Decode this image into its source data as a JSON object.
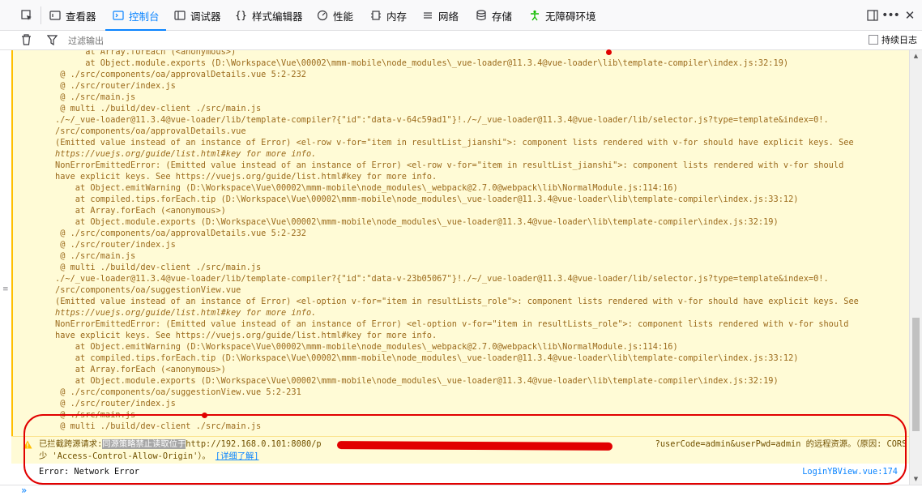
{
  "toolbar": {
    "tabs": [
      {
        "label": "查看器",
        "icon": "inspector-icon"
      },
      {
        "label": "控制台",
        "icon": "console-icon",
        "active": true
      },
      {
        "label": "调试器",
        "icon": "debugger-icon"
      },
      {
        "label": "样式编辑器",
        "icon": "style-editor-icon"
      },
      {
        "label": "性能",
        "icon": "performance-icon"
      },
      {
        "label": "内存",
        "icon": "memory-icon"
      },
      {
        "label": "网络",
        "icon": "network-icon"
      },
      {
        "label": "存储",
        "icon": "storage-icon"
      },
      {
        "label": "无障碍环境",
        "icon": "accessibility-icon"
      }
    ],
    "accent": "#0a84ff"
  },
  "filterbar": {
    "placeholder": "过滤输出",
    "persist_label": "持续日志"
  },
  "log": {
    "lines": [
      "      at Array.forEach (<anonymous>)",
      "      at Object.module.exports (D:\\Workspace\\Vue\\00002\\mmm-mobile\\node_modules\\_vue-loader@11.3.4@vue-loader\\lib\\template-compiler\\index.js:32:19)",
      " @ ./src/components/oa/approvalDetails.vue 5:2-232",
      " @ ./src/router/index.js",
      " @ ./src/main.js",
      " @ multi ./build/dev-client ./src/main.js",
      "./~/_vue-loader@11.3.4@vue-loader/lib/template-compiler?{\"id\":\"data-v-64c59ad1\"}!./~/_vue-loader@11.3.4@vue-loader/lib/selector.js?type=template&index=0!.",
      "/src/components/oa/approvalDetails.vue",
      "(Emitted value instead of an instance of Error) <el-row v-for=\"item in resultList_jianshi\">: component lists rendered with v-for should have explicit keys. See",
      "https://vuejs.org/guide/list.html#key for more info.",
      "NonErrorEmittedError: (Emitted value instead of an instance of Error) <el-row v-for=\"item in resultList_jianshi\">: component lists rendered with v-for should",
      "have explicit keys. See https://vuejs.org/guide/list.html#key for more info.",
      "    at Object.emitWarning (D:\\Workspace\\Vue\\00002\\mmm-mobile\\node_modules\\_webpack@2.7.0@webpack\\lib\\NormalModule.js:114:16)",
      "    at compiled.tips.forEach.tip (D:\\Workspace\\Vue\\00002\\mmm-mobile\\node_modules\\_vue-loader@11.3.4@vue-loader\\lib\\template-compiler\\index.js:33:12)",
      "    at Array.forEach (<anonymous>)",
      "    at Object.module.exports (D:\\Workspace\\Vue\\00002\\mmm-mobile\\node_modules\\_vue-loader@11.3.4@vue-loader\\lib\\template-compiler\\index.js:32:19)",
      " @ ./src/components/oa/approvalDetails.vue 5:2-232",
      " @ ./src/router/index.js",
      " @ ./src/main.js",
      " @ multi ./build/dev-client ./src/main.js",
      "./~/_vue-loader@11.3.4@vue-loader/lib/template-compiler?{\"id\":\"data-v-23b05067\"}!./~/_vue-loader@11.3.4@vue-loader/lib/selector.js?type=template&index=0!.",
      "/src/components/oa/suggestionView.vue",
      "(Emitted value instead of an instance of Error) <el-option v-for=\"item in resultLists_role\">: component lists rendered with v-for should have explicit keys. See",
      "https://vuejs.org/guide/list.html#key for more info.",
      "NonErrorEmittedError: (Emitted value instead of an instance of Error) <el-option v-for=\"item in resultLists_role\">: component lists rendered with v-for should",
      "have explicit keys. See https://vuejs.org/guide/list.html#key for more info.",
      "    at Object.emitWarning (D:\\Workspace\\Vue\\00002\\mmm-mobile\\node_modules\\_webpack@2.7.0@webpack\\lib\\NormalModule.js:114:16)",
      "    at compiled.tips.forEach.tip (D:\\Workspace\\Vue\\00002\\mmm-mobile\\node_modules\\_vue-loader@11.3.4@vue-loader\\lib\\template-compiler\\index.js:33:12)",
      "    at Array.forEach (<anonymous>)",
      "    at Object.module.exports (D:\\Workspace\\Vue\\00002\\mmm-mobile\\node_modules\\_vue-loader@11.3.4@vue-loader\\lib\\template-compiler\\index.js:32:19)",
      " @ ./src/components/oa/suggestionView.vue 5:2-231",
      " @ ./src/router/index.js",
      " @ ./src/main.js",
      " @ multi ./build/dev-client ./src/main.js"
    ],
    "warning_color": "#9b6a1b"
  },
  "cors": {
    "prefix": "已拦截跨源请求:",
    "highlight": "同源策略禁止读取位于",
    "url_start": "http://192.168.0.101:8080/p",
    "url_end": "?userCode=admin&userPwd=admin 的远程资源。（原因: CORS 头缺",
    "line2": "少 'Access-Control-Allow-Origin'）。",
    "link": "[详细了解]"
  },
  "error": {
    "message": "Error: Network Error",
    "source": "LoginYBView.vue:174"
  },
  "prompt": "»"
}
